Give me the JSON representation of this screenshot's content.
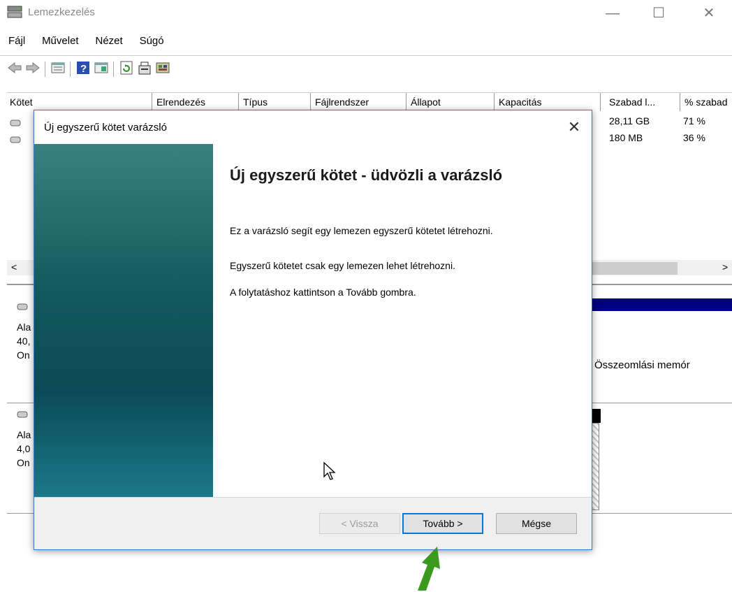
{
  "window": {
    "title": "Lemezkezelés",
    "minimize": "—",
    "maximize": "☐",
    "close": "✕"
  },
  "menu": [
    "Fájl",
    "Művelet",
    "Nézet",
    "Súgó"
  ],
  "toolbar_icons": [
    "back-arrow-icon",
    "forward-arrow-icon",
    "disk-list-icon",
    "help-icon",
    "view-icon",
    "refresh-icon",
    "properties-icon",
    "settings-icon"
  ],
  "list": {
    "columns": [
      "Kötet",
      "Elrendezés",
      "Típus",
      "Fájlrendszer",
      "Állapot",
      "Kapacitás",
      "Szabad l...",
      "% szabad"
    ],
    "rows": [
      {
        "free": "28,11 GB",
        "pct": "71 %"
      },
      {
        "free": "180 MB",
        "pct": "36 %"
      }
    ],
    "scroll_left": "<",
    "scroll_right": ">"
  },
  "graph": {
    "disk0": {
      "line1": "Ala",
      "line2": "40,",
      "line3": "On"
    },
    "disk0_partition_text": "jl, Összeomlási memór",
    "disk1": {
      "line1": "Ala",
      "line2": "4,0",
      "line3": "On"
    }
  },
  "dialog": {
    "title": "Új egyszerű kötet varázsló",
    "close": "✕",
    "heading": "Új egyszerű kötet - üdvözli a varázsló",
    "para1": "Ez a varázsló segít egy lemezen egyszerű kötetet létrehozni.",
    "para2": "Egyszerű kötetet csak egy lemezen lehet létrehozni.",
    "para3": "A folytatáshoz kattintson a Tovább gombra.",
    "back_label": "< Vissza",
    "next_label": "Tovább >",
    "cancel_label": "Mégse"
  },
  "colors": {
    "accent": "#0078d7",
    "arrow": "#3a9a1e",
    "banner": "#145a5e"
  }
}
